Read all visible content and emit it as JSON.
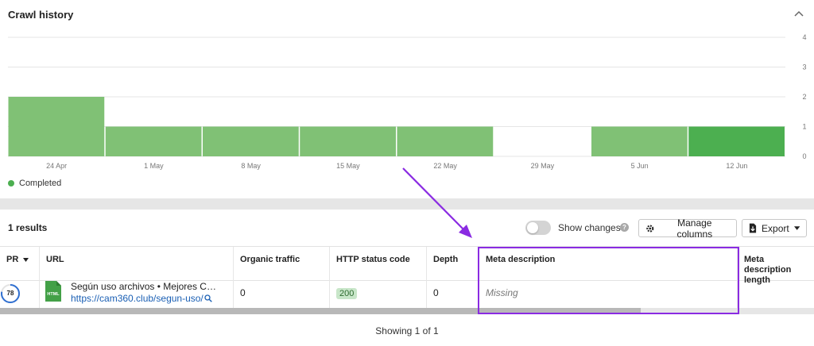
{
  "crawl_history": {
    "title": "Crawl history",
    "collapse_icon": "chevron-up-icon",
    "legend": {
      "label": "Completed",
      "color": "#4caf50"
    }
  },
  "chart_data": {
    "type": "bar",
    "title": "",
    "xlabel": "",
    "ylabel": "",
    "ylim": [
      0,
      4
    ],
    "y_ticks": [
      "0",
      "1",
      "2",
      "3",
      "4"
    ],
    "x_tick_labels": [
      "24 Apr",
      "1 May",
      "8 May",
      "15 May",
      "22 May",
      "29 May",
      "5 Jun",
      "12 Jun"
    ],
    "values": [
      2,
      1,
      1,
      1,
      1,
      0,
      1,
      1
    ],
    "colors": [
      "#80c175",
      "#80c175",
      "#80c175",
      "#80c175",
      "#80c175",
      "#80c175",
      "#80c175",
      "#4caf50"
    ],
    "grid": true,
    "y_axis_position": "right"
  },
  "results": {
    "count_label": "1 results",
    "show_changes_label": "Show changes",
    "help_icon": "question-icon",
    "manage_columns_label": "Manage columns",
    "export_label": "Export"
  },
  "table": {
    "columns": [
      "PR",
      "URL",
      "Organic traffic",
      "HTTP status code",
      "Depth",
      "Meta description",
      "Meta description length"
    ],
    "row": {
      "pr": "78",
      "file_icon": "html-file-icon",
      "file_icon_text": "HTML",
      "title": "Según uso archivos • Mejores C…",
      "url": "https://cam360.club/segun-uso/",
      "organic_traffic": "0",
      "http_status": "200",
      "depth": "0",
      "meta_description": "Missing",
      "meta_description_length": ""
    }
  },
  "pagination": {
    "label": "Showing 1 of 1"
  },
  "annotation": {
    "color": "#8a2be2"
  }
}
